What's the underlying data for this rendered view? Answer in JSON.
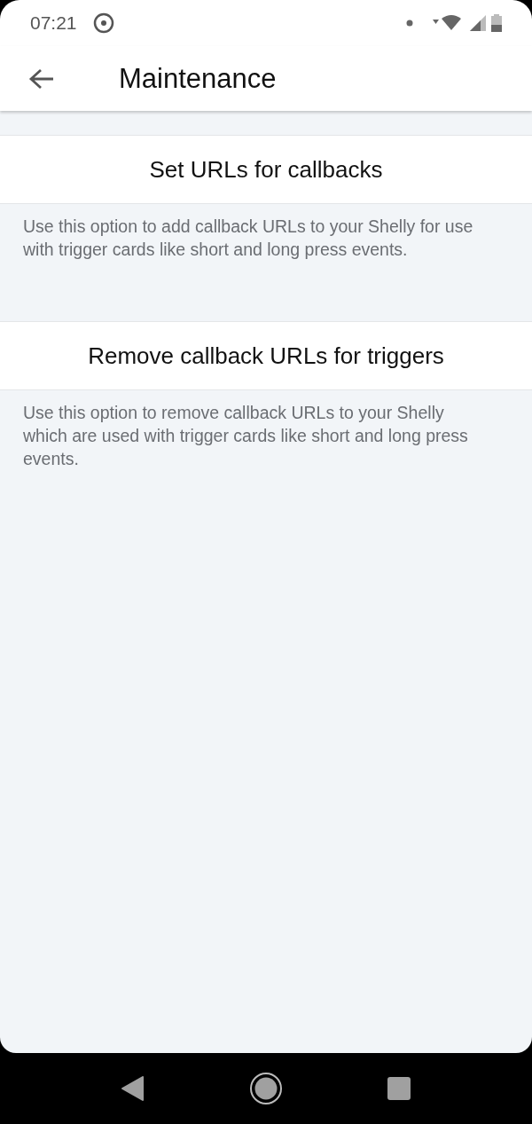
{
  "status_bar": {
    "time": "07:21"
  },
  "app_bar": {
    "title": "Maintenance"
  },
  "options": [
    {
      "title": "Set URLs for callbacks",
      "description": "Use this option to add callback URLs to your Shelly for use with trigger cards like short and long press events."
    },
    {
      "title": "Remove callback URLs for triggers",
      "description": "Use this option to remove callback URLs to your Shelly which are used with trigger cards like short and long press events."
    }
  ]
}
